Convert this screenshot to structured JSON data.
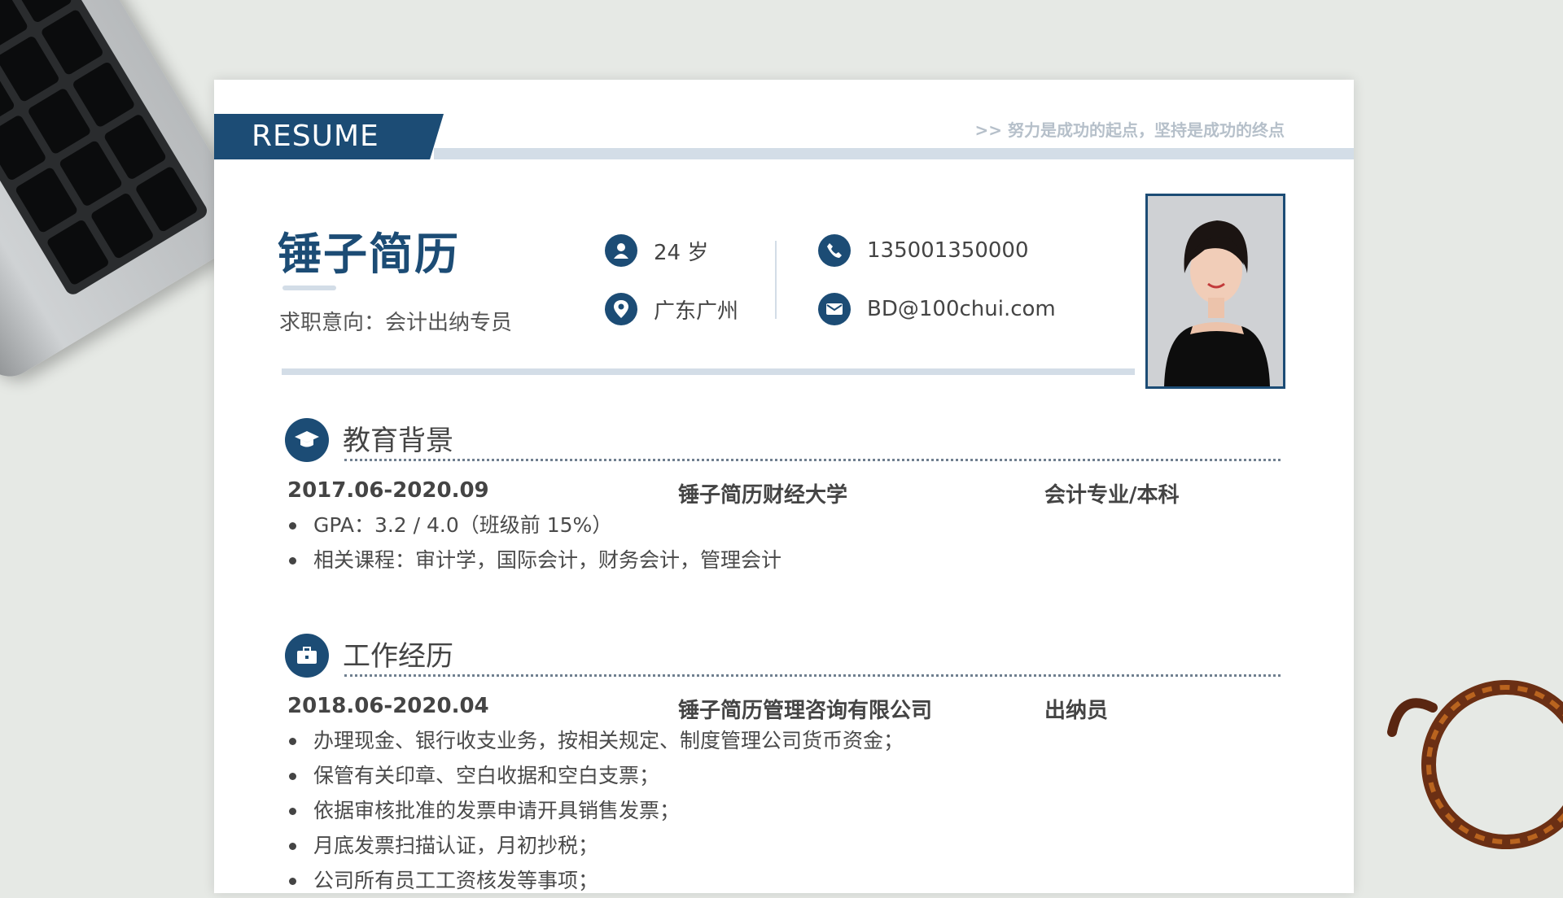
{
  "header": {
    "tag": "RESUME",
    "motto": ">>  努力是成功的起点，坚持是成功的终点"
  },
  "profile": {
    "name": "锤子简历",
    "intent": "求职意向：会计出纳专员",
    "age": "24 岁",
    "location": "广东广州",
    "phone": "135001350000",
    "email": "BD@100chui.com"
  },
  "education": {
    "title": "教育背景",
    "period": "2017.06-2020.09",
    "school": "锤子简历财经大学",
    "major": "会计专业/本科",
    "items": [
      "GPA：3.2 / 4.0（班级前 15%）",
      "相关课程：审计学，国际会计，财务会计，管理会计"
    ]
  },
  "work": {
    "title": "工作经历",
    "period": "2018.06-2020.04",
    "company": "锤子简历管理咨询有限公司",
    "position": "出纳员",
    "items": [
      "办理现金、银行收支业务，按相关规定、制度管理公司货币资金；",
      "保管有关印章、空白收据和空白支票；",
      "依据审核批准的发票申请开具销售发票；",
      "月底发票扫描认证，月初抄税；",
      "公司所有员工工资核发等事项；"
    ]
  },
  "colors": {
    "accent": "#1c4c75",
    "light": "#d3dde7"
  },
  "icons": [
    "user-icon",
    "location-icon",
    "phone-icon",
    "mail-icon",
    "graduation-cap-icon",
    "briefcase-icon"
  ]
}
